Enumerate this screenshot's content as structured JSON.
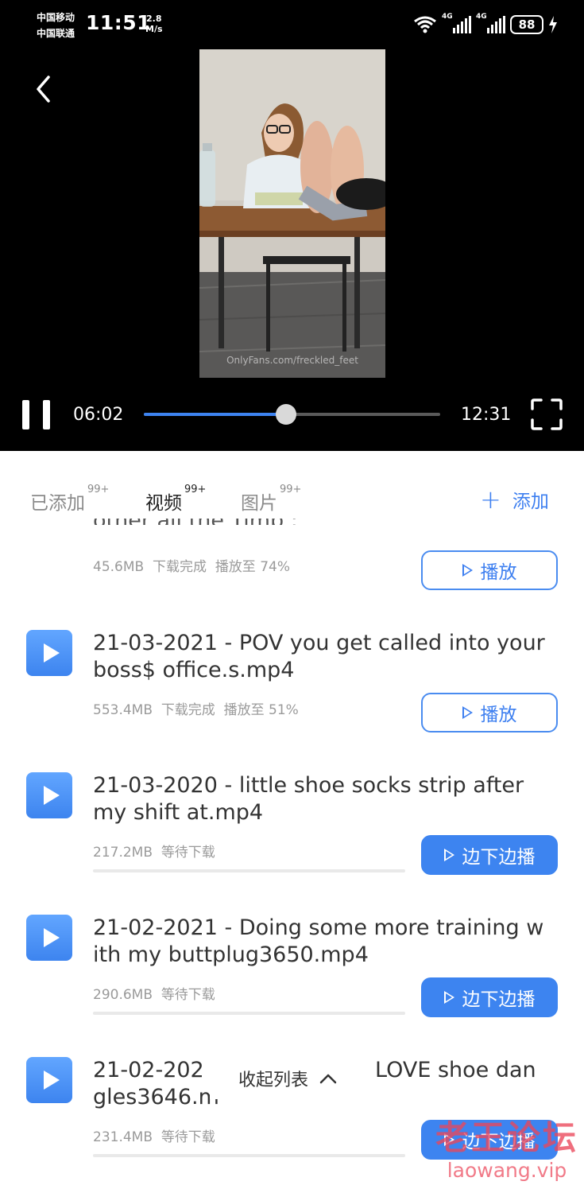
{
  "status_bar": {
    "carrier_1": "中国移动",
    "carrier_2": "中国联通",
    "time": "11:51",
    "net_speed_value": "2.8",
    "net_speed_unit": "M/s",
    "signal_1_label": "4G",
    "signal_2_label": "4G",
    "battery": "88",
    "icons": [
      "wifi-icon",
      "signal-icon",
      "signal-icon",
      "battery-icon",
      "charging-icon"
    ]
  },
  "player": {
    "video_watermark": "OnlyFans.com/freckled_feet",
    "current_time": "06:02",
    "total_time": "12:31",
    "progress": 0.48,
    "accent_color": "#3d83f0",
    "icons": [
      "back-icon",
      "pause-icon",
      "fullscreen-icon"
    ]
  },
  "tabs": [
    {
      "label": "已添加",
      "badge": "99+",
      "active": false
    },
    {
      "label": "视频",
      "badge": "99+",
      "active": true
    },
    {
      "label": "图片",
      "badge": "99+",
      "active": false
    }
  ],
  "add_button": {
    "label": "添加",
    "icon": "plus-icon"
  },
  "list": {
    "partial_item": {
      "title_fragment": "other all the Timp :",
      "size": "45.6MB",
      "status": "下载完成",
      "progress_text": "播放至 74%",
      "button": "播放"
    },
    "items": [
      {
        "title": "21-03-2021 - POV  you get called into your boss$ office.s.mp4",
        "size": "553.4MB",
        "status": "下载完成",
        "progress_text": "播放至 51%",
        "button": "播放"
      },
      {
        "title": "21-03-2020 -  little shoe   socks strip after my shift at.mp4",
        "size": "217.2MB",
        "status": "等待下载",
        "progress_text": "",
        "button": "边下边播"
      },
      {
        "title": "21-02-2021 - Doing some more training with my buttplug3650.mp4",
        "size": "290.6MB",
        "status": "等待下载",
        "progress_text": "",
        "button": "边下边播"
      },
      {
        "title_left": "21-02-202",
        "title_right": "LOVE shoe dan",
        "title_line2": "gles3646.m",
        "size": "231.4MB",
        "status": "等待下载",
        "progress_text": "",
        "button": "边下边播"
      }
    ]
  },
  "collapse_button": {
    "label": "收起列表",
    "icon": "chevron-up-icon"
  },
  "watermark": {
    "line1": "老王论坛",
    "line2": "laowang.vip"
  }
}
